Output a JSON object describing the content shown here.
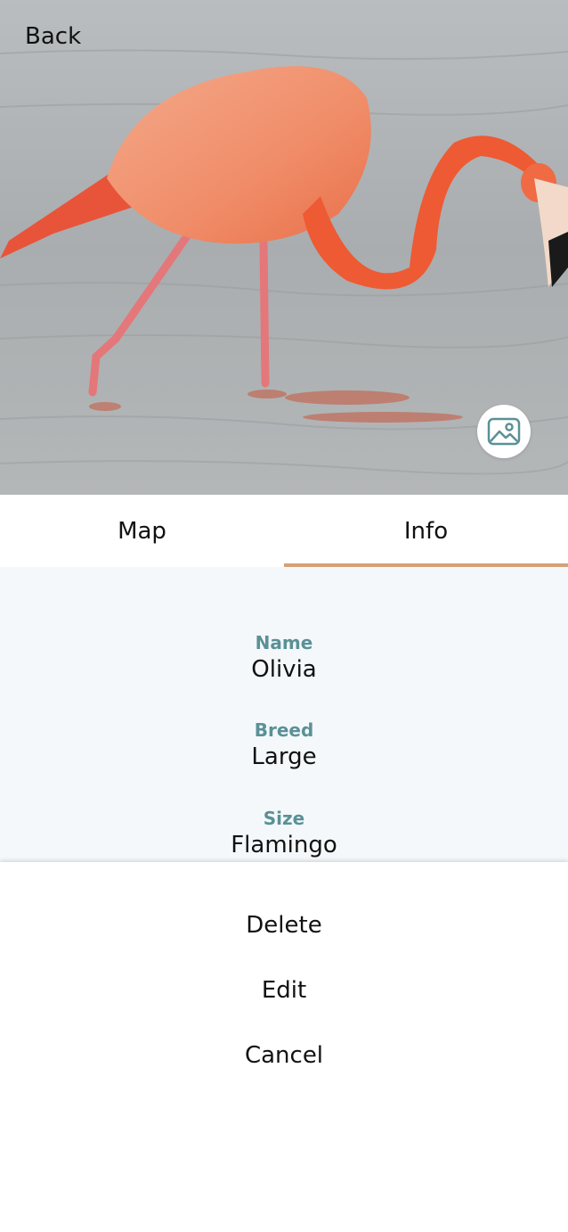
{
  "header": {
    "back_label": "Back",
    "photo_subject": "flamingo-photo",
    "gallery_icon": "image-icon"
  },
  "tabs": [
    {
      "label": "Map",
      "active": false
    },
    {
      "label": "Info",
      "active": true
    }
  ],
  "info": {
    "fields": [
      {
        "label": "Name",
        "value": "Olivia"
      },
      {
        "label": "Breed",
        "value": "Large"
      },
      {
        "label": "Size",
        "value": "Flamingo"
      }
    ]
  },
  "actions": {
    "delete_label": "Delete",
    "edit_label": "Edit",
    "cancel_label": "Cancel"
  },
  "colors": {
    "accent": "#d4a077",
    "label": "#5a9196",
    "panel_bg": "#f4f8fb"
  }
}
